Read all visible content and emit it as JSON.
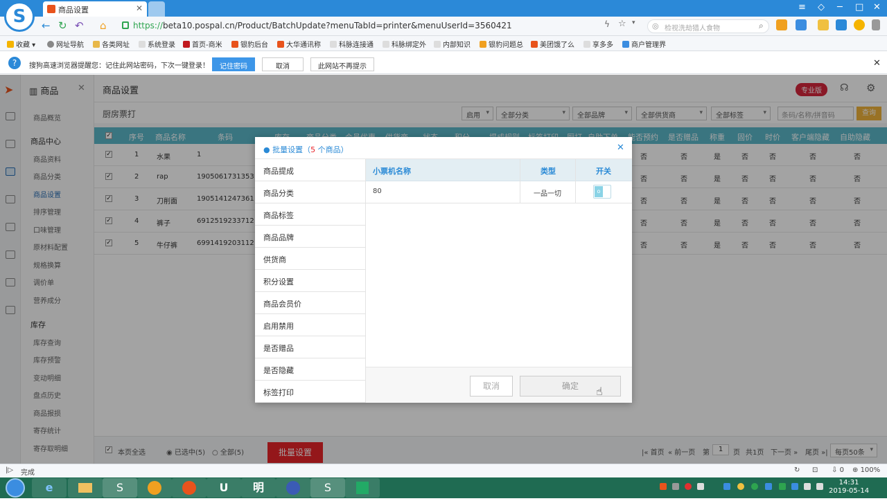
{
  "browser": {
    "tab_title": "商品设置",
    "url_protocol": "https://",
    "url_rest": "beta10.pospal.cn/Product/BatchUpdate?menuTabId=printer&menuUserId=3560421",
    "search_placeholder": "检视洗劫猎人食物",
    "bookmarks": [
      "收藏",
      "网址导航",
      "各类网址",
      "系统登录",
      "首页-商米",
      "银豹后台",
      "大华通讯称",
      "科脉连接通",
      "科脉绑定外",
      "内部知识",
      "银豹问题总",
      "美团饿了么",
      "享多多",
      "商户管理界"
    ],
    "password_bar": {
      "message": "搜狗高速浏览器提醒您：记住此网站密码，下次一键登录！",
      "remember": "记住密码",
      "cancel": "取消",
      "never": "此网站不再提示"
    },
    "status_text": "完成",
    "zoom": "100%",
    "download_count": "0"
  },
  "app": {
    "sidebar_title": "商品",
    "sidebar": {
      "overview": "商品概览",
      "group1": "商品中心",
      "items1": [
        "商品资料",
        "商品分类",
        "商品设置",
        "排序管理",
        "口味管理",
        "原材料配置",
        "规格换算",
        "调价单",
        "营养成分"
      ],
      "group2": "库存",
      "items2": [
        "库存查询",
        "库存预警",
        "变动明细",
        "盘点历史",
        "商品报损",
        "寄存统计",
        "寄存取明细"
      ]
    },
    "page_title": "商品设置",
    "edition": "专业版",
    "sub_title": "厨房票打",
    "filters": [
      "启用",
      "全部分类",
      "全部品牌",
      "全部供货商",
      "全部标签"
    ],
    "search_placeholder": "条码/名称/拼音码",
    "search_button": "查询",
    "table": {
      "headers": [
        "序号",
        "商品名称",
        "条码",
        "库存",
        "商品分类",
        "会员优惠",
        "供货商",
        "状态",
        "积分",
        "提成规则",
        "标签打印",
        "厨打",
        "自助下单",
        "能否预约",
        "是否赠品",
        "称重",
        "固价",
        "时价",
        "客户端隐藏",
        "自助隐藏"
      ],
      "rows": [
        {
          "no": "1",
          "name": "水果",
          "barcode": "1",
          "vals": [
            "否",
            "否",
            "是",
            "否",
            "否",
            "否",
            "否"
          ]
        },
        {
          "no": "2",
          "name": "rap",
          "barcode": "1905061731353",
          "vals": [
            "否",
            "否",
            "是",
            "否",
            "否",
            "否",
            "否"
          ]
        },
        {
          "no": "3",
          "name": "刀削面",
          "barcode": "1905141247361",
          "vals": [
            "否",
            "否",
            "是",
            "否",
            "否",
            "否",
            "否"
          ]
        },
        {
          "no": "4",
          "name": "裤子",
          "barcode": "6912519233712",
          "vals": [
            "否",
            "否",
            "是",
            "否",
            "否",
            "否",
            "否"
          ]
        },
        {
          "no": "5",
          "name": "牛仔裤",
          "barcode": "6991419203112",
          "vals": [
            "否",
            "否",
            "是",
            "否",
            "否",
            "否",
            "否"
          ]
        }
      ]
    },
    "footer": {
      "select_page": "本页全选",
      "selected": "已选中(5)",
      "all": "全部(5)",
      "batch_button": "批量设置",
      "first": "首页",
      "prev": "前一页",
      "page_label_pre": "第",
      "page_number": "1",
      "page_label_post": "页",
      "total": "共1页",
      "next": "下一页",
      "last": "尾页",
      "per_page": "每页50条"
    }
  },
  "modal": {
    "title_pre": "批量设置（",
    "title_count": "5",
    "title_post": " 个商品）",
    "nav": [
      "商品提成",
      "商品分类",
      "商品标签",
      "商品品牌",
      "供货商",
      "积分设置",
      "商品会员价",
      "启用禁用",
      "是否赠品",
      "是否隐藏",
      "标签打印"
    ],
    "headers": [
      "小票机名称",
      "类型",
      "开关"
    ],
    "row": {
      "name": "80",
      "type": "一品一切",
      "toggle_glyph": "o"
    },
    "cancel": "取消",
    "confirm": "确定"
  },
  "taskbar": {
    "time": "14:31",
    "date": "2019-05-14",
    "apps": [
      "e",
      "",
      "S",
      "",
      "",
      "U",
      "明",
      "",
      "S",
      ""
    ]
  }
}
